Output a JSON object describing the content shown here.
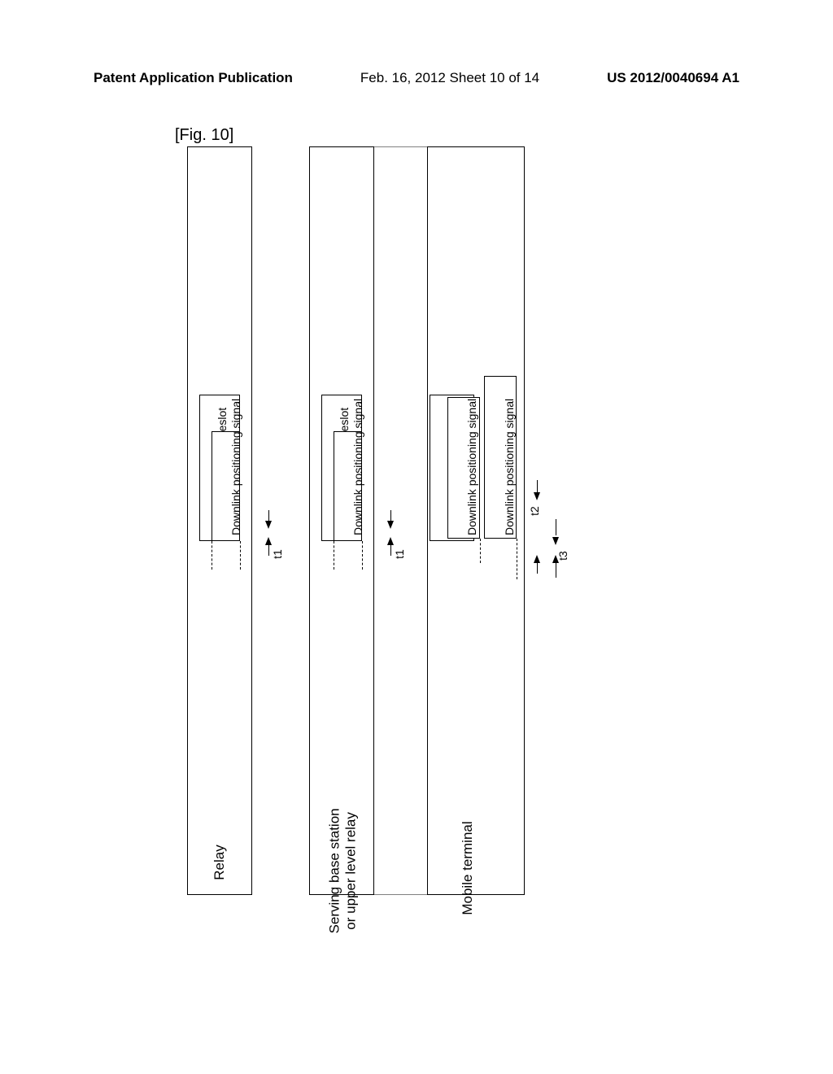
{
  "header": {
    "left": "Patent Application Publication",
    "center": "Feb. 16, 2012  Sheet 10 of 14",
    "right": "US 2012/0040694 A1"
  },
  "figure": {
    "label": "[Fig. 10]"
  },
  "lanes": {
    "relay": "Relay",
    "serving": "Serving base station\nor upper level relay",
    "mobile": "Mobile terminal"
  },
  "boxes": {
    "reference_signal_timeslot": "Reference signal timeslot",
    "downlink_positioning_signal": "Downlink positioning signal"
  },
  "times": {
    "t1": "t1",
    "t2": "t2",
    "t3": "t3"
  }
}
